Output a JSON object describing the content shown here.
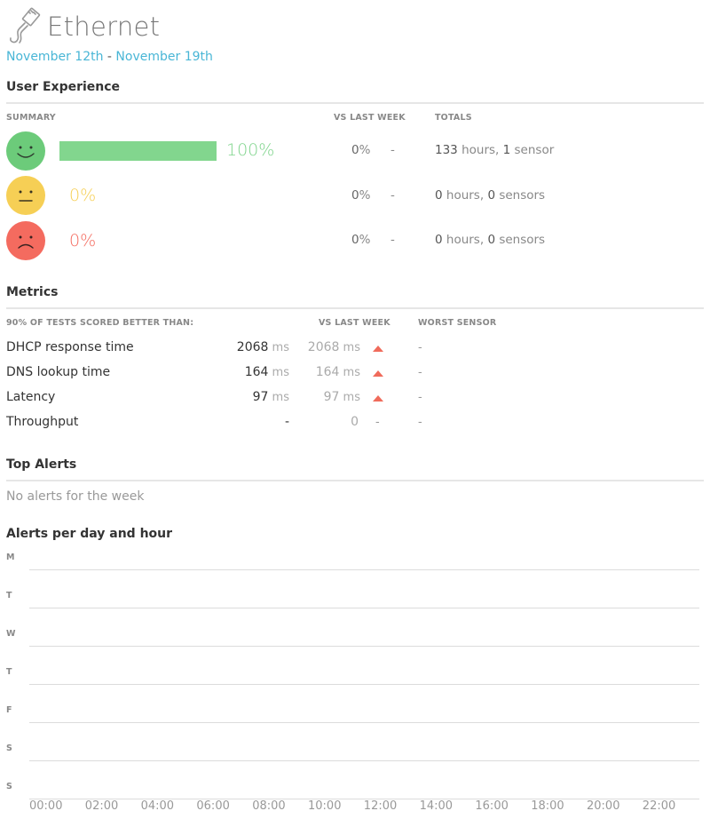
{
  "header": {
    "title": "Ethernet",
    "date_start": "November 12th",
    "date_sep": " - ",
    "date_end": "November 19th"
  },
  "user_experience": {
    "title": "User Experience",
    "columns": {
      "summary": "SUMMARY",
      "vs_last_week": "VS LAST WEEK",
      "totals": "TOTALS"
    },
    "rows": [
      {
        "mood": "happy",
        "color": "#6ccb7a",
        "bar_fraction": 1.0,
        "percent": "100%",
        "vs_value": "0",
        "vs_unit": "%",
        "vs_dash": "-",
        "hours": "133",
        "hours_unit": " hours, ",
        "sensors": "1",
        "sensors_unit": " sensor"
      },
      {
        "mood": "neutral",
        "color": "#f6cf55",
        "bar_fraction": 0,
        "percent": "0%",
        "vs_value": "0",
        "vs_unit": "%",
        "vs_dash": "-",
        "hours": "0",
        "hours_unit": " hours, ",
        "sensors": "0",
        "sensors_unit": " sensors"
      },
      {
        "mood": "sad",
        "color": "#f46b5f",
        "bar_fraction": 0,
        "percent": "0%",
        "vs_value": "0",
        "vs_unit": "%",
        "vs_dash": "-",
        "hours": "0",
        "hours_unit": " hours, ",
        "sensors": "0",
        "sensors_unit": " sensors"
      }
    ]
  },
  "metrics": {
    "title": "Metrics",
    "columns": {
      "scored": "90% OF TESTS SCORED BETTER THAN:",
      "vs_last_week": "VS LAST WEEK",
      "worst_sensor": "WORST SENSOR"
    },
    "rows": [
      {
        "label": "DHCP response time",
        "value": "2068",
        "unit": " ms",
        "prev": "2068",
        "prev_unit": " ms",
        "trend": "up",
        "trend_text": "",
        "worst": "-"
      },
      {
        "label": "DNS lookup time",
        "value": "164",
        "unit": " ms",
        "prev": "164",
        "prev_unit": " ms",
        "trend": "up",
        "trend_text": "",
        "worst": "-"
      },
      {
        "label": "Latency",
        "value": "97",
        "unit": " ms",
        "prev": "97",
        "prev_unit": " ms",
        "trend": "up",
        "trend_text": "",
        "worst": "-"
      },
      {
        "label": "Throughput",
        "value": "-",
        "unit": "",
        "prev": "0",
        "prev_unit": "",
        "trend": "none",
        "trend_text": "-",
        "worst": "-"
      }
    ]
  },
  "top_alerts": {
    "title": "Top Alerts",
    "empty_text": "No alerts for the week"
  },
  "alerts_chart": {
    "title": "Alerts per day and hour",
    "days": [
      "M",
      "T",
      "W",
      "T",
      "F",
      "S",
      "S"
    ],
    "hours": [
      "00:00",
      "02:00",
      "04:00",
      "06:00",
      "08:00",
      "10:00",
      "12:00",
      "14:00",
      "16:00",
      "18:00",
      "20:00",
      "22:00"
    ]
  },
  "chart_data": {
    "type": "heatmap",
    "title": "Alerts per day and hour",
    "y_categories": [
      "M",
      "T",
      "W",
      "T",
      "F",
      "S",
      "S"
    ],
    "x_ticks": [
      "00:00",
      "02:00",
      "04:00",
      "06:00",
      "08:00",
      "10:00",
      "12:00",
      "14:00",
      "16:00",
      "18:00",
      "20:00",
      "22:00"
    ],
    "values": []
  },
  "colors": {
    "accent": "#49b6d6",
    "good": "#6ccb7a",
    "neutral": "#f6cf55",
    "bad": "#f46b5f",
    "trend_up": "#f06b5b"
  }
}
